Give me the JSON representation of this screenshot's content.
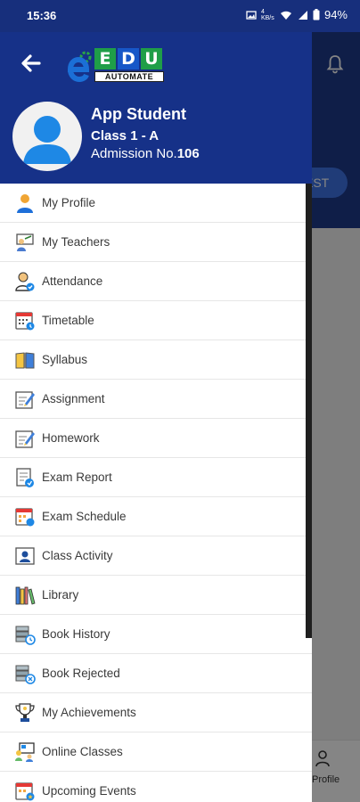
{
  "status_bar": {
    "time": "15:36",
    "network_speed": "4 KB/s",
    "battery": "94%"
  },
  "background": {
    "test_button_label": "EST",
    "profile_label": "Profile"
  },
  "drawer": {
    "logo": {
      "letters": [
        "E",
        "D",
        "U"
      ],
      "subtitle": "AUTOMATE"
    },
    "user": {
      "name": "App Student",
      "class": "Class 1 - A",
      "admission_label": "Admission No.",
      "admission_no": "106"
    },
    "menu": [
      {
        "label": "My Profile",
        "icon": "profile-icon"
      },
      {
        "label": "My Teachers",
        "icon": "teachers-icon"
      },
      {
        "label": "Attendance",
        "icon": "attendance-icon"
      },
      {
        "label": "Timetable",
        "icon": "timetable-icon"
      },
      {
        "label": "Syllabus",
        "icon": "syllabus-icon"
      },
      {
        "label": "Assignment",
        "icon": "assignment-icon"
      },
      {
        "label": "Homework",
        "icon": "homework-icon"
      },
      {
        "label": "Exam Report",
        "icon": "exam-report-icon"
      },
      {
        "label": "Exam Schedule",
        "icon": "exam-schedule-icon"
      },
      {
        "label": "Class Activity",
        "icon": "class-activity-icon"
      },
      {
        "label": "Library",
        "icon": "library-icon"
      },
      {
        "label": "Book History",
        "icon": "book-history-icon"
      },
      {
        "label": "Book Rejected",
        "icon": "book-rejected-icon"
      },
      {
        "label": "My Achievements",
        "icon": "achievements-icon"
      },
      {
        "label": "Online Classes",
        "icon": "online-classes-icon"
      },
      {
        "label": "Upcoming Events",
        "icon": "upcoming-events-icon"
      }
    ]
  },
  "colors": {
    "header_blue": "#163188",
    "status_blue": "#172f7c",
    "logo_e_green": "#2aa845",
    "logo_e_blue": "#1b6fd6",
    "logo_box_green": "#1f9e48",
    "logo_box_blue": "#1757c8",
    "logo_box_red": "#e53935"
  }
}
